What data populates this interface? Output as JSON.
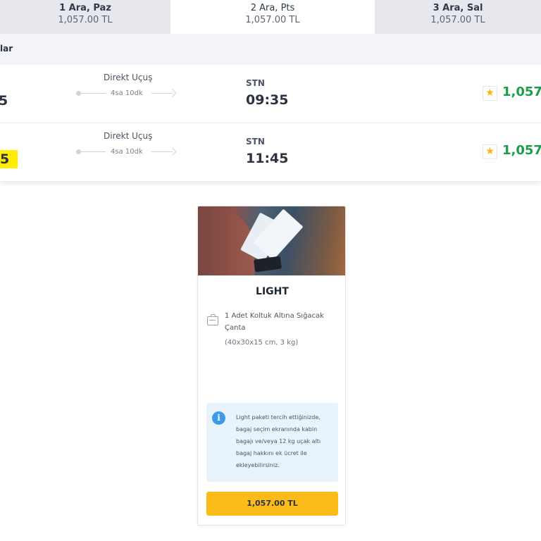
{
  "date_tabs": [
    {
      "day": "1 Ara, Paz",
      "price": "1,057.00 TL",
      "active": false
    },
    {
      "day": "2 Ara, Pts",
      "price": "1,057.00 TL",
      "active": true
    },
    {
      "day": "3 Ara, Sal",
      "price": "1,057.00 TL",
      "active": false
    }
  ],
  "list_header": {
    "label": "lar"
  },
  "flights": [
    {
      "dep_time_partial": "5",
      "type": "Direkt Uçuş",
      "duration": "4sa 10dk",
      "arr_code": "STN",
      "arr_time": "09:35",
      "price_partial": "1,057.",
      "highlighted": false
    },
    {
      "dep_time_partial": "5",
      "type": "Direkt Uçuş",
      "duration": "4sa 10dk",
      "arr_code": "STN",
      "arr_time": "11:45",
      "price_partial": "1,057.",
      "highlighted": true
    }
  ],
  "package_card": {
    "title": "LIGHT",
    "baggage_text": "1 Adet Koltuk Altına Sığacak Çanta",
    "baggage_dims": "(40x30x15 cm, 3 kg)",
    "info_icon_glyph": "i",
    "info_text": "Light paketi tercih ettiğinizde, bagaj seçim ekranında kabin bagajı ve/veya 12 kg uçak altı bagaj hakkını ek ücret ile ekleyebilirsiniz.",
    "button_label": "1,057.00 TL"
  },
  "icons": {
    "star": "star-icon",
    "baggage": "baggage-icon",
    "info": "info-icon"
  },
  "colors": {
    "accent_yellow": "#fbbc19",
    "price_green": "#1a9e4b",
    "highlight": "#ffee00",
    "info_bg": "#e8f3fb",
    "info_icon": "#3d9ae8"
  }
}
